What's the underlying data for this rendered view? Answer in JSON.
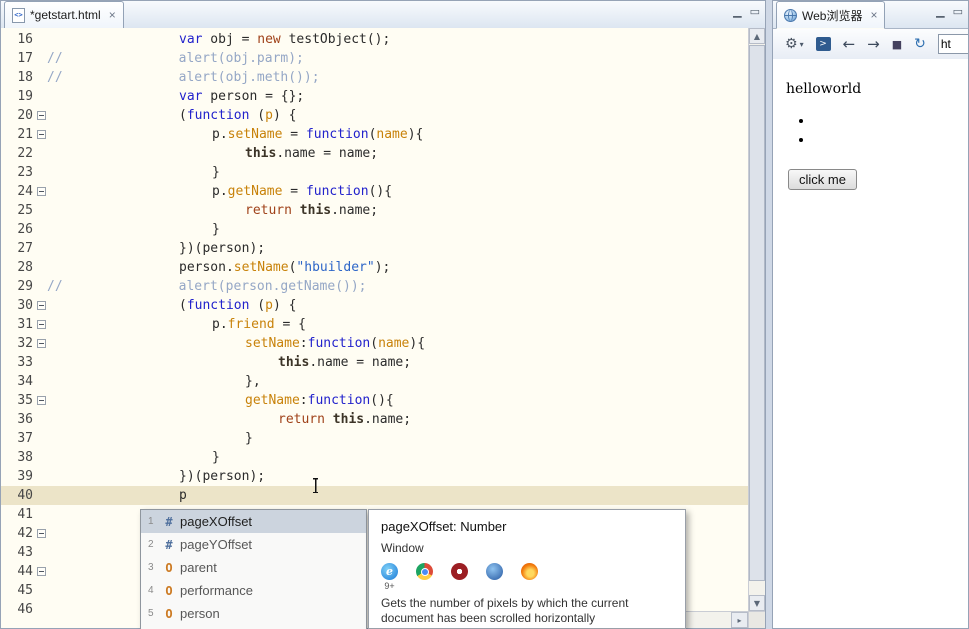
{
  "window_controls": {
    "minimize": "▁",
    "maximize": "▭"
  },
  "scrollbar": {
    "up": "▲",
    "down": "▼",
    "right": "▸"
  },
  "editor_panel": {
    "tab": {
      "icon_text": "<>",
      "title": "*getstart.html",
      "close": "×"
    },
    "lines": [
      {
        "n": "16",
        "indent": 4,
        "tokens": [
          {
            "t": "var",
            "c": "kw"
          },
          {
            "t": " obj = ",
            "c": "pl"
          },
          {
            "t": "new",
            "c": "kw2"
          },
          {
            "t": " testObject();",
            "c": "pl"
          }
        ]
      },
      {
        "n": "17",
        "pre": "//",
        "indent": 4,
        "tokens": [
          {
            "t": "alert(obj.parm);",
            "c": "cm"
          }
        ]
      },
      {
        "n": "18",
        "pre": "//",
        "indent": 4,
        "tokens": [
          {
            "t": "alert(obj.meth());",
            "c": "cm"
          }
        ]
      },
      {
        "n": "19",
        "indent": 4,
        "tokens": [
          {
            "t": "var",
            "c": "kw"
          },
          {
            "t": " person = {};",
            "c": "pl"
          }
        ]
      },
      {
        "n": "20",
        "fold": true,
        "indent": 4,
        "tokens": [
          {
            "t": "(",
            "c": "pl"
          },
          {
            "t": "function",
            "c": "kw"
          },
          {
            "t": " (",
            "c": "pl"
          },
          {
            "t": "p",
            "c": "par"
          },
          {
            "t": ") {",
            "c": "pl"
          }
        ]
      },
      {
        "n": "21",
        "fold": true,
        "indent": 5,
        "tokens": [
          {
            "t": "p.",
            "c": "pl"
          },
          {
            "t": "setName",
            "c": "fn"
          },
          {
            "t": " = ",
            "c": "pl"
          },
          {
            "t": "function",
            "c": "kw"
          },
          {
            "t": "(",
            "c": "pl"
          },
          {
            "t": "name",
            "c": "par"
          },
          {
            "t": "){",
            "c": "pl"
          }
        ]
      },
      {
        "n": "22",
        "indent": 6,
        "tokens": [
          {
            "t": "this",
            "c": "this"
          },
          {
            "t": ".name = name;",
            "c": "pl"
          }
        ]
      },
      {
        "n": "23",
        "indent": 5,
        "tokens": [
          {
            "t": "}",
            "c": "pl"
          }
        ]
      },
      {
        "n": "24",
        "fold": true,
        "indent": 5,
        "tokens": [
          {
            "t": "p.",
            "c": "pl"
          },
          {
            "t": "getName",
            "c": "fn"
          },
          {
            "t": " = ",
            "c": "pl"
          },
          {
            "t": "function",
            "c": "kw"
          },
          {
            "t": "(){",
            "c": "pl"
          }
        ]
      },
      {
        "n": "25",
        "indent": 6,
        "tokens": [
          {
            "t": "return",
            "c": "kw2"
          },
          {
            "t": " ",
            "c": "pl"
          },
          {
            "t": "this",
            "c": "this"
          },
          {
            "t": ".name;",
            "c": "pl"
          }
        ]
      },
      {
        "n": "26",
        "indent": 5,
        "tokens": [
          {
            "t": "}",
            "c": "pl"
          }
        ]
      },
      {
        "n": "27",
        "indent": 4,
        "tokens": [
          {
            "t": "})(person);",
            "c": "pl"
          }
        ]
      },
      {
        "n": "28",
        "indent": 4,
        "tokens": [
          {
            "t": "person.",
            "c": "pl"
          },
          {
            "t": "setName",
            "c": "fn"
          },
          {
            "t": "(",
            "c": "pl"
          },
          {
            "t": "\"hbuilder\"",
            "c": "str"
          },
          {
            "t": ");",
            "c": "pl"
          }
        ]
      },
      {
        "n": "29",
        "pre": "//",
        "indent": 4,
        "tokens": [
          {
            "t": "alert(person.getName());",
            "c": "cm"
          }
        ]
      },
      {
        "n": "30",
        "fold": true,
        "indent": 4,
        "tokens": [
          {
            "t": "(",
            "c": "pl"
          },
          {
            "t": "function",
            "c": "kw"
          },
          {
            "t": " (",
            "c": "pl"
          },
          {
            "t": "p",
            "c": "par"
          },
          {
            "t": ") {",
            "c": "pl"
          }
        ]
      },
      {
        "n": "31",
        "fold": true,
        "indent": 5,
        "tokens": [
          {
            "t": "p.",
            "c": "pl"
          },
          {
            "t": "friend",
            "c": "fn"
          },
          {
            "t": " = {",
            "c": "pl"
          }
        ]
      },
      {
        "n": "32",
        "fold": true,
        "indent": 6,
        "tokens": [
          {
            "t": "setName",
            "c": "fn"
          },
          {
            "t": ":",
            "c": "pl"
          },
          {
            "t": "function",
            "c": "kw"
          },
          {
            "t": "(",
            "c": "pl"
          },
          {
            "t": "name",
            "c": "par"
          },
          {
            "t": "){",
            "c": "pl"
          }
        ]
      },
      {
        "n": "33",
        "indent": 7,
        "tokens": [
          {
            "t": "this",
            "c": "this"
          },
          {
            "t": ".name = name;",
            "c": "pl"
          }
        ]
      },
      {
        "n": "34",
        "indent": 6,
        "tokens": [
          {
            "t": "},",
            "c": "pl"
          }
        ]
      },
      {
        "n": "35",
        "fold": true,
        "indent": 6,
        "tokens": [
          {
            "t": "getName",
            "c": "fn"
          },
          {
            "t": ":",
            "c": "pl"
          },
          {
            "t": "function",
            "c": "kw"
          },
          {
            "t": "(){",
            "c": "pl"
          }
        ]
      },
      {
        "n": "36",
        "indent": 7,
        "tokens": [
          {
            "t": "return",
            "c": "kw2"
          },
          {
            "t": " ",
            "c": "pl"
          },
          {
            "t": "this",
            "c": "this"
          },
          {
            "t": ".name;",
            "c": "pl"
          }
        ]
      },
      {
        "n": "37",
        "indent": 6,
        "tokens": [
          {
            "t": "}",
            "c": "pl"
          }
        ]
      },
      {
        "n": "38",
        "indent": 5,
        "tokens": [
          {
            "t": "}",
            "c": "pl"
          }
        ]
      },
      {
        "n": "39",
        "indent": 4,
        "tokens": [
          {
            "t": "})(person);",
            "c": "pl"
          }
        ]
      },
      {
        "n": "40",
        "indent": 4,
        "cur": true,
        "tokens": [
          {
            "t": "p",
            "c": "pl"
          }
        ]
      },
      {
        "n": "41",
        "indent": 0,
        "tokens": []
      },
      {
        "n": "42",
        "fold": true,
        "indent": 0,
        "tokens": []
      },
      {
        "n": "43",
        "indent": 0,
        "tokens": []
      },
      {
        "n": "44",
        "fold": true,
        "indent": 0,
        "tokens": []
      },
      {
        "n": "45",
        "indent": 0,
        "tokens": []
      },
      {
        "n": "46",
        "indent": 0,
        "tokens": []
      }
    ]
  },
  "assist": {
    "items": [
      {
        "num": "1",
        "glyph": "#",
        "kind": "prop",
        "label": "pageXOffset",
        "selected": true
      },
      {
        "num": "2",
        "glyph": "#",
        "kind": "prop",
        "label": "pageYOffset",
        "selected": false
      },
      {
        "num": "3",
        "glyph": "O",
        "kind": "obj",
        "label": "parent",
        "selected": false
      },
      {
        "num": "4",
        "glyph": "O",
        "kind": "obj",
        "label": "performance",
        "selected": false
      },
      {
        "num": "5",
        "glyph": "O",
        "kind": "obj",
        "label": "person",
        "selected": false
      }
    ]
  },
  "tooltip": {
    "title": "pageXOffset: Number",
    "owner": "Window",
    "browsers": [
      {
        "name": "ie",
        "letter": "e",
        "badge": "9+"
      },
      {
        "name": "chrome"
      },
      {
        "name": "opera"
      },
      {
        "name": "safari"
      },
      {
        "name": "firefox"
      }
    ],
    "desc": "Gets the number of pixels by which the current document has been scrolled horizontally"
  },
  "browser_panel": {
    "tab": {
      "title": "Web浏览器",
      "close": "×"
    },
    "toolbar": {
      "icons": [
        {
          "name": "settings-gear-icon",
          "glyph": "⚙",
          "dropdown_glyph": "▾"
        },
        {
          "name": "open-external-browser-icon",
          "glyph": ">"
        },
        {
          "name": "back-icon",
          "glyph": "←"
        },
        {
          "name": "forward-icon",
          "glyph": "→"
        },
        {
          "name": "stop-icon",
          "glyph": "■"
        },
        {
          "name": "refresh-icon",
          "glyph": "↻"
        }
      ],
      "url_value": "ht"
    },
    "content": {
      "heading": "helloworld",
      "list_items": [
        "",
        ""
      ],
      "button_label": "click me"
    }
  }
}
